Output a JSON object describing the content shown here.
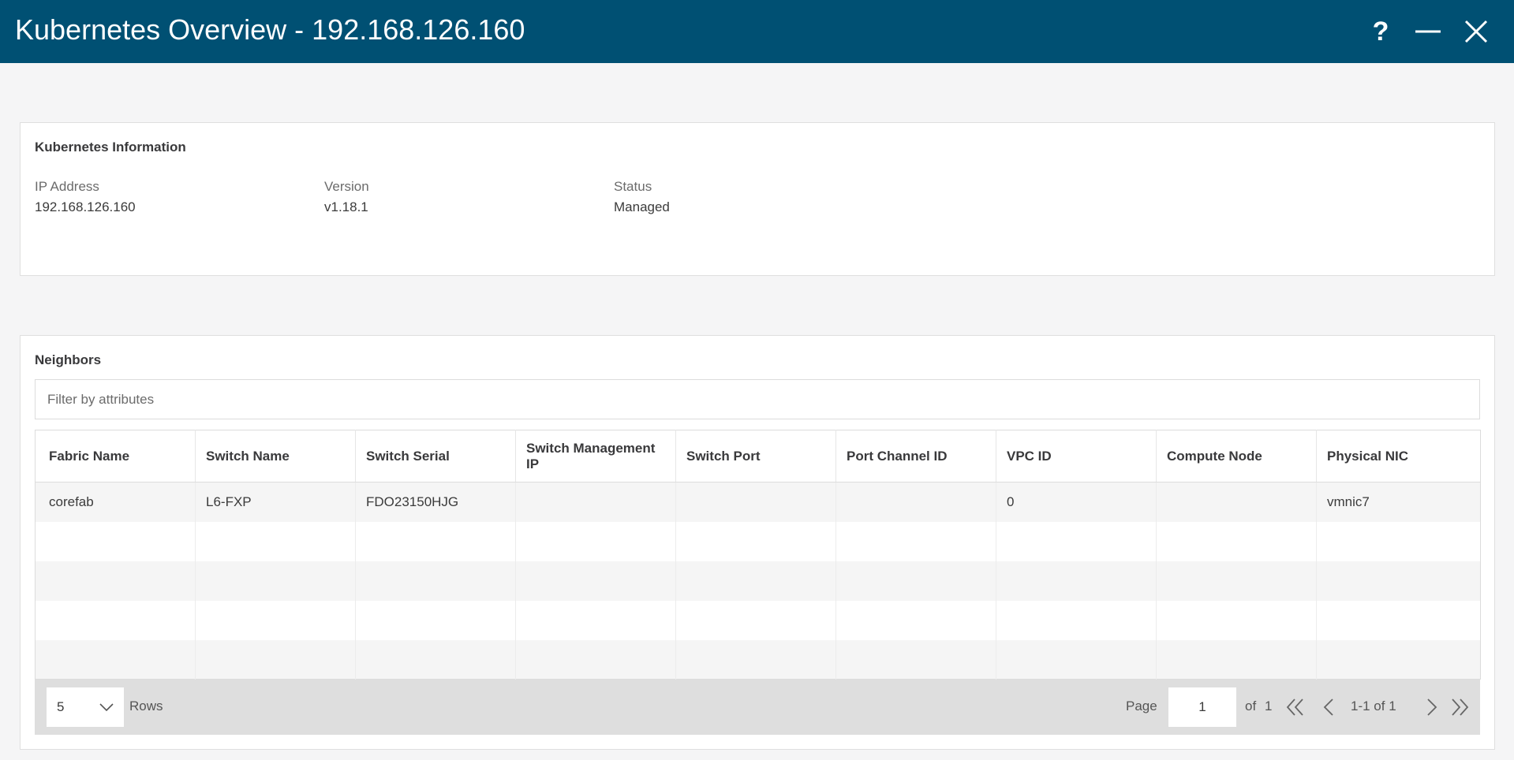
{
  "window": {
    "title": "Kubernetes Overview - 192.168.126.160",
    "help_label": "?"
  },
  "info": {
    "title": "Kubernetes Information",
    "fields": [
      {
        "label": "IP Address",
        "value": "192.168.126.160"
      },
      {
        "label": "Version",
        "value": "v1.18.1"
      },
      {
        "label": "Status",
        "value": "Managed"
      }
    ]
  },
  "neighbors": {
    "title": "Neighbors",
    "filter_placeholder": "Filter by attributes",
    "columns": [
      "Fabric Name",
      "Switch Name",
      "Switch Serial",
      "Switch Management IP",
      "Switch Port",
      "Port Channel ID",
      "VPC ID",
      "Compute Node",
      "Physical NIC"
    ],
    "rows": [
      [
        "corefab",
        "L6-FXP",
        "FDO23150HJG",
        "",
        "",
        "",
        "0",
        "",
        "vmnic7"
      ]
    ],
    "empty_row_count": 4
  },
  "pagination": {
    "rows_per_page": "5",
    "rows_label": "Rows",
    "page_label": "Page",
    "current_page": "1",
    "of_label": "of",
    "total_pages": "1",
    "range_label": "1-1 of 1"
  },
  "colors": {
    "titlebar": "#005073",
    "background": "#f5f5f6",
    "pager": "#dedede"
  }
}
